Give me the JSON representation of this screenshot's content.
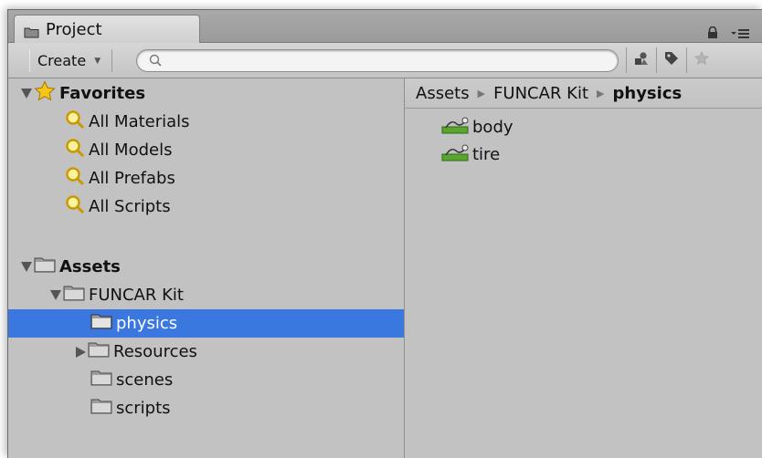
{
  "window": {
    "tab_title": "Project"
  },
  "toolbar": {
    "create_label": "Create",
    "search_placeholder": ""
  },
  "favorites": {
    "label": "Favorites",
    "items": [
      {
        "label": "All Materials"
      },
      {
        "label": "All Models"
      },
      {
        "label": "All Prefabs"
      },
      {
        "label": "All Scripts"
      }
    ]
  },
  "assets": {
    "label": "Assets",
    "funcar_label": "FUNCAR Kit",
    "children": [
      {
        "label": "physics"
      },
      {
        "label": "Resources"
      },
      {
        "label": "scenes"
      },
      {
        "label": "scripts"
      }
    ]
  },
  "breadcrumb": {
    "items": [
      "Assets",
      "FUNCAR Kit",
      "physics"
    ]
  },
  "content": {
    "items": [
      {
        "label": "body"
      },
      {
        "label": "tire"
      }
    ]
  },
  "colors": {
    "selection": "#3a78e0",
    "panel": "#c2c2c2"
  }
}
